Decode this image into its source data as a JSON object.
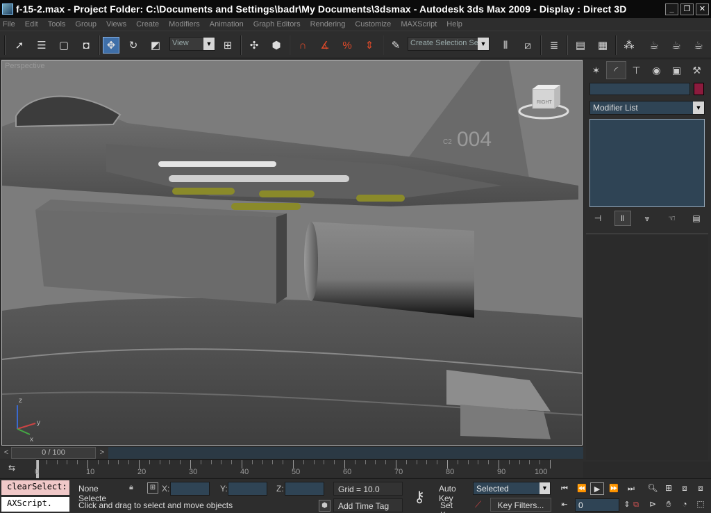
{
  "window": {
    "title": "f-15-2.max     - Project Folder: C:\\Documents and Settings\\badr\\My Documents\\3dsmax     - Autodesk 3ds Max  2009     - Display : Direct 3D",
    "minimize": "_",
    "restore": "❐",
    "close": "✕"
  },
  "menu": [
    "File",
    "Edit",
    "Tools",
    "Group",
    "Views",
    "Create",
    "Modifiers",
    "Animation",
    "Graph Editors",
    "Rendering",
    "Customize",
    "MAXScript",
    "Help"
  ],
  "toolbar": {
    "reference_coord": "View",
    "named_selection": "Create Selection Set"
  },
  "viewport": {
    "label": "Perspective",
    "viewcube_face": "RIGHT",
    "tail_text": "004",
    "tail_small_text": "C2"
  },
  "command_panel": {
    "modifier_list": "Modifier List",
    "object_color": "#8c1b3d"
  },
  "time_slider": {
    "position": "0 / 100",
    "prev": "<",
    "next": ">"
  },
  "trackbar": {
    "labels": [
      "0",
      "10",
      "20",
      "30",
      "40",
      "50",
      "60",
      "70",
      "80",
      "90",
      "100"
    ]
  },
  "status": {
    "listener_line1": "clearSelect:",
    "listener_line2": "AXScript.",
    "selection_info": "None Selecte",
    "x_label": "X:",
    "y_label": "Y:",
    "z_label": "Z:",
    "grid": "Grid = 10.0",
    "prompt": "Click and drag to select and move objects",
    "add_time_tag": "Add Time Tag",
    "auto_key": "Auto Key",
    "set_key": "Set Key",
    "key_mode": "Selected",
    "key_filters": "Key Filters...",
    "current_frame": "0"
  }
}
